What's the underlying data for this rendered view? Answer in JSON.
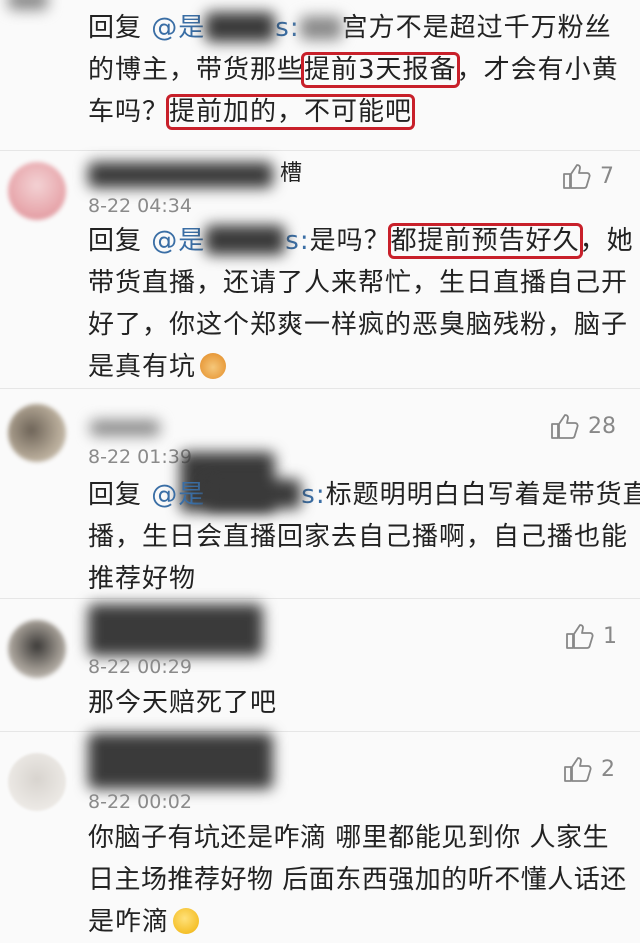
{
  "comments": [
    {
      "reply_label": "回复",
      "at": "@",
      "mention_visible": "是",
      "mention_tail": "s:",
      "lines": [
        {
          "a": "宫方不是超过千万粉丝"
        },
        {
          "a": "的博主，带货那些",
          "hl": "提前3天报备",
          "b": "，才会有小黄"
        },
        {
          "a": "车吗？",
          "hl": "提前加的，不可能吧"
        }
      ]
    },
    {
      "username_visible": "槽",
      "date": "8-22 04:34",
      "likes": "7",
      "reply_label": "回复",
      "at": "@",
      "mention_visible": "是",
      "mention_tail": "s:",
      "line1_a": "是吗？",
      "line1_hl": "都提前预告好久",
      "line1_b": "，她",
      "line2": "带货直播，还请了人来帮忙，生日直播自己开",
      "line3": "好了，你这个郑爽一样疯的恶臭脑残粉，脑子",
      "line4": "是真有坑"
    },
    {
      "date": "8-22 01:39",
      "likes": "28",
      "reply_label": "回复",
      "at": "@",
      "mention_visible": "是",
      "mention_tail": "s:",
      "line1": "标题明明白白写着是带货直",
      "line2": "播，生日会直播回家去自己播啊，自己播也能",
      "line3": "推荐好物"
    },
    {
      "date": "8-22 00:29",
      "likes": "1",
      "line1": "那今天赔死了吧"
    },
    {
      "date": "8-22 00:02",
      "likes": "2",
      "line1": "你脑子有坑还是咋滴 哪里都能见到你 人家生",
      "line2": "日主场推荐好物 后面东西强加的听不懂人话还",
      "line3": "是咋滴"
    }
  ],
  "icons": {
    "like": "thumbs-up-icon",
    "emoji_pray": "praying-hands-emoji-icon",
    "emoji_sweat": "sweat-smile-emoji-icon"
  },
  "colors": {
    "highlight_box": "#c8202a",
    "mention": "#3a6ea5",
    "meta": "#8a8a8a",
    "background": "#fafafa"
  }
}
